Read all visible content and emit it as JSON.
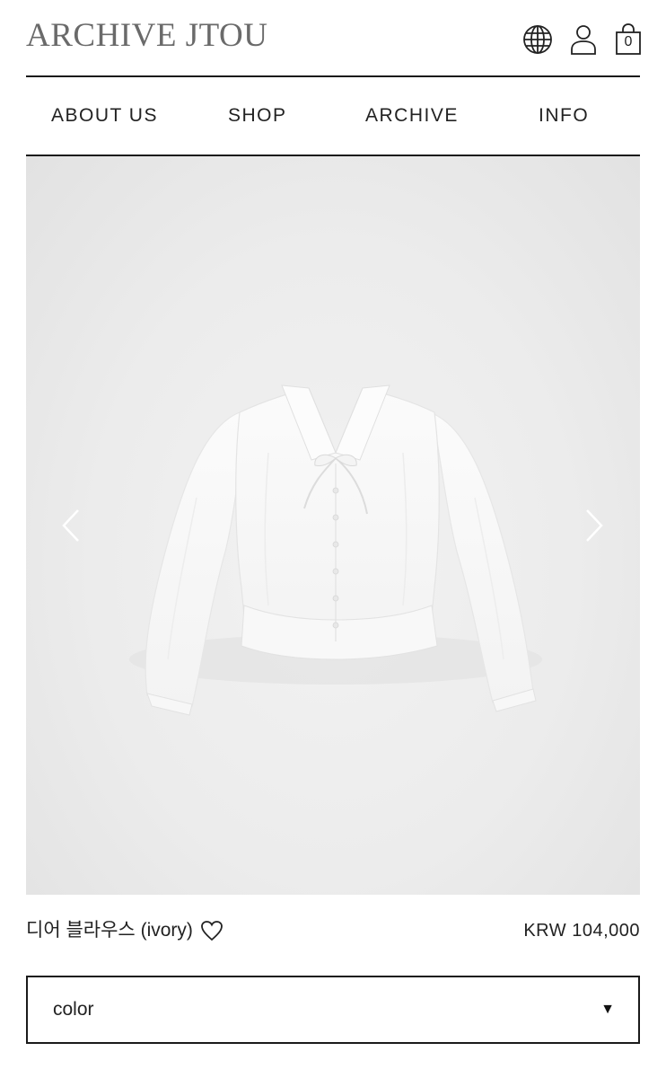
{
  "header": {
    "logo": "ARCHIVE JTOU",
    "cart_count": "0",
    "icons": [
      "globe-icon",
      "user-icon",
      "shopping-bag-icon"
    ]
  },
  "nav": {
    "items": [
      {
        "label": "ABOUT US"
      },
      {
        "label": "SHOP"
      },
      {
        "label": "ARCHIVE"
      },
      {
        "label": "INFO"
      }
    ]
  },
  "gallery": {
    "image": "white-blouse-photo",
    "prev_icon": "chevron-left-icon",
    "next_icon": "chevron-right-icon"
  },
  "product": {
    "name": "디어 블라우스 (ivory)",
    "price": "KRW 104,000",
    "wishlist_icon": "heart-icon"
  },
  "option_select": {
    "label": "color",
    "caret": "▼"
  },
  "colors": {
    "text": "#222222",
    "border": "#1a1a1a",
    "logo": "#6a6a6a",
    "photo_bg": "#ececec"
  }
}
